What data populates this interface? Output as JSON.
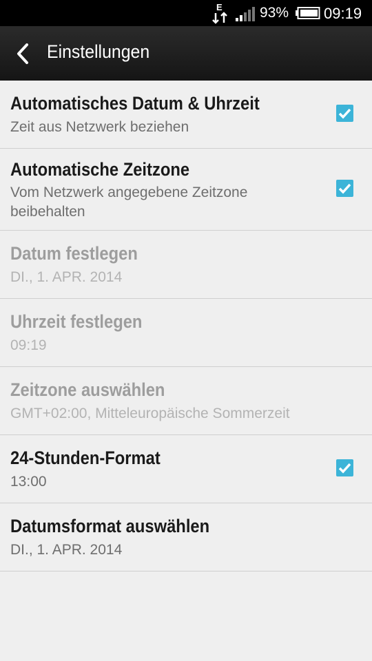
{
  "status_bar": {
    "network_letter": "E",
    "battery_percent": "93%",
    "time": "09:19",
    "signal_icon": "signal-bars-icon",
    "battery_icon": "battery-icon"
  },
  "action_bar": {
    "back_icon": "chevron-left-icon",
    "title": "Einstellungen"
  },
  "settings": [
    {
      "title": "Automatisches Datum & Uhrzeit",
      "summary": "Zeit aus Netzwerk beziehen",
      "checked": true,
      "enabled": true
    },
    {
      "title": "Automatische Zeitzone",
      "summary": "Vom Netzwerk angegebene Zeitzone beibehalten",
      "checked": true,
      "enabled": true
    },
    {
      "title": "Datum festlegen",
      "summary": "DI., 1. APR. 2014",
      "enabled": false
    },
    {
      "title": "Uhrzeit festlegen",
      "summary": "09:19",
      "enabled": false
    },
    {
      "title": "Zeitzone auswählen",
      "summary": "GMT+02:00, Mitteleuropäische Sommerzeit",
      "enabled": false
    },
    {
      "title": "24-Stunden-Format",
      "summary": "13:00",
      "checked": true,
      "enabled": true
    },
    {
      "title": "Datumsformat auswählen",
      "summary": "DI., 1. APR. 2014",
      "enabled": true
    }
  ],
  "colors": {
    "checkbox": "#3cb4d8",
    "background": "#efefef",
    "action_bar": "#1e1e1e"
  }
}
